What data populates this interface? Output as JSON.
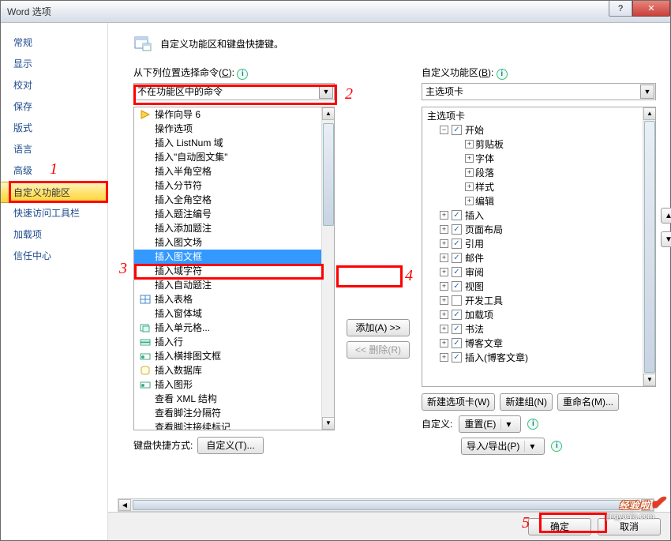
{
  "window": {
    "title": "Word 选项"
  },
  "sidebar": {
    "items": [
      {
        "label": "常规"
      },
      {
        "label": "显示"
      },
      {
        "label": "校对"
      },
      {
        "label": "保存"
      },
      {
        "label": "版式"
      },
      {
        "label": "语言"
      },
      {
        "label": "高级"
      },
      {
        "label": "自定义功能区",
        "selected": true
      },
      {
        "label": "快速访问工具栏"
      },
      {
        "label": "加载项"
      },
      {
        "label": "信任中心"
      }
    ]
  },
  "header": {
    "text": "自定义功能区和键盘快捷键。"
  },
  "leftCol": {
    "label_pre": "从下列位置选择命令(",
    "label_u": "C",
    "label_post": "):",
    "dropdown": "不在功能区中的命令",
    "items": [
      {
        "icon": "wz",
        "label": "操作向导 6"
      },
      {
        "icon": "",
        "label": "操作选项"
      },
      {
        "icon": "",
        "label": "插入 ListNum 域"
      },
      {
        "icon": "",
        "label": "插入\"自动图文集\""
      },
      {
        "icon": "",
        "label": "插入半角空格"
      },
      {
        "icon": "",
        "label": "插入分节符"
      },
      {
        "icon": "",
        "label": "插入全角空格"
      },
      {
        "icon": "",
        "label": "插入题注编号"
      },
      {
        "icon": "",
        "label": "插入添加题注"
      },
      {
        "icon": "",
        "label": "插入图文场"
      },
      {
        "icon": "",
        "label": "插入图文框",
        "selected": true
      },
      {
        "icon": "",
        "label": "插入域字符"
      },
      {
        "icon": "",
        "label": "插入自动题注"
      },
      {
        "icon": "tb",
        "label": "插入表格"
      },
      {
        "icon": "",
        "label": "插入窗体域"
      },
      {
        "icon": "cl",
        "label": "插入单元格..."
      },
      {
        "icon": "rw",
        "label": "插入行"
      },
      {
        "icon": "sh",
        "label": "插入横排图文框"
      },
      {
        "icon": "db",
        "label": "插入数据库"
      },
      {
        "icon": "sh",
        "label": "插入图形"
      },
      {
        "icon": "",
        "label": "查看 XML 结构"
      },
      {
        "icon": "",
        "label": "查看脚注分隔符"
      },
      {
        "icon": "",
        "label": "查看脚注接续标记"
      }
    ],
    "keyboard_label": "键盘快捷方式:",
    "keyboard_btn": "自定义(T)..."
  },
  "midCol": {
    "add_btn": "添加(A) >>",
    "remove_btn": "<< 删除(R)"
  },
  "rightCol": {
    "label_pre": "自定义功能区(",
    "label_u": "B",
    "label_post": "):",
    "dropdown": "主选项卡",
    "tree_root": "主选项卡",
    "tree": [
      {
        "lvl": 2,
        "exp": "-",
        "chk": true,
        "label": "开始"
      },
      {
        "lvl": 3,
        "exp": "+",
        "label": "剪贴板"
      },
      {
        "lvl": 3,
        "exp": "+",
        "label": "字体"
      },
      {
        "lvl": 3,
        "exp": "+",
        "label": "段落"
      },
      {
        "lvl": 3,
        "exp": "+",
        "label": "样式"
      },
      {
        "lvl": 3,
        "exp": "+",
        "label": "编辑"
      },
      {
        "lvl": 2,
        "exp": "+",
        "chk": true,
        "label": "插入"
      },
      {
        "lvl": 2,
        "exp": "+",
        "chk": true,
        "label": "页面布局"
      },
      {
        "lvl": 2,
        "exp": "+",
        "chk": true,
        "label": "引用"
      },
      {
        "lvl": 2,
        "exp": "+",
        "chk": true,
        "label": "邮件"
      },
      {
        "lvl": 2,
        "exp": "+",
        "chk": true,
        "label": "审阅"
      },
      {
        "lvl": 2,
        "exp": "+",
        "chk": true,
        "label": "视图"
      },
      {
        "lvl": 2,
        "exp": "+",
        "chk": false,
        "label": "开发工具"
      },
      {
        "lvl": 2,
        "exp": "+",
        "chk": true,
        "label": "加载项"
      },
      {
        "lvl": 2,
        "exp": "+",
        "chk": true,
        "label": "书法"
      },
      {
        "lvl": 2,
        "exp": "+",
        "chk": true,
        "label": "博客文章"
      },
      {
        "lvl": 2,
        "exp": "+",
        "chk": true,
        "label": "插入(博客文章)"
      }
    ],
    "btn_newtab": "新建选项卡(W)",
    "btn_newgroup": "新建组(N)",
    "btn_rename": "重命名(M)...",
    "reset_label": "自定义:",
    "btn_reset": "重置(E)",
    "btn_import": "导入/导出(P)"
  },
  "footer": {
    "ok": "确定",
    "cancel": "取消"
  },
  "annotations": {
    "n1": "1",
    "n2": "2",
    "n3": "3",
    "n4": "4",
    "n5": "5"
  },
  "watermark": {
    "main": "经验啦",
    "sub": "jingyanla.com"
  }
}
